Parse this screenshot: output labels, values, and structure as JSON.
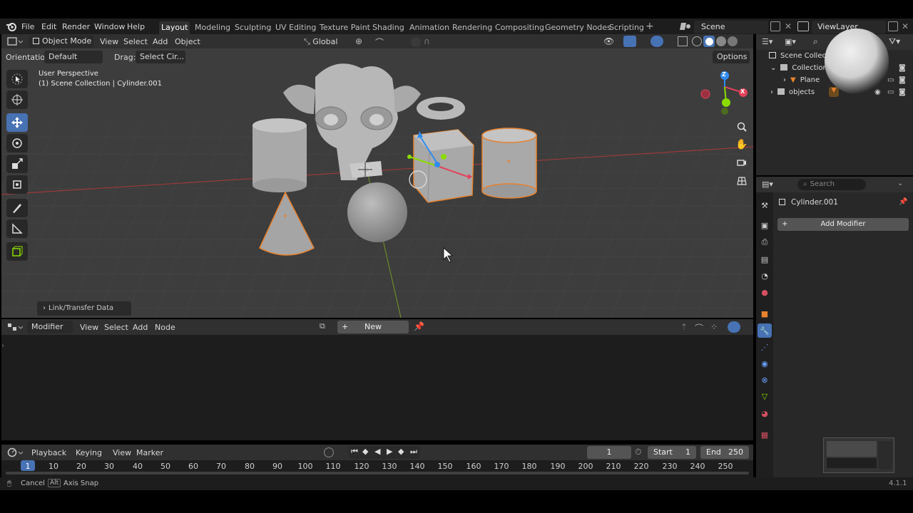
{
  "topbar": {
    "menus": [
      "File",
      "Edit",
      "Render",
      "Window",
      "Help"
    ],
    "workspaces": [
      "Layout",
      "Modeling",
      "Sculpting",
      "UV Editing",
      "Texture Paint",
      "Shading",
      "Animation",
      "Rendering",
      "Compositing",
      "Geometry Nodes",
      "Scripting"
    ],
    "active_workspace": "Layout",
    "scene_name": "Scene",
    "view_layer_name": "ViewLayer"
  },
  "viewport": {
    "mode": "Object Mode",
    "menus": [
      "View",
      "Select",
      "Add",
      "Object"
    ],
    "transform_orientation": "Global",
    "orientation_label": "Orientation:",
    "orientation_value": "Default",
    "drag_label": "Drag:",
    "drag_value": "Select Cir...",
    "options_label": "Options",
    "perspective": "User Perspective",
    "collection_info": "(1) Scene Collection | Cylinder.001",
    "last_op_panel": "Link/Transfer Data",
    "gizmo_axes": [
      "Z",
      "X"
    ]
  },
  "node_editor": {
    "type": "Modifier",
    "menus": [
      "View",
      "Select",
      "Add",
      "Node"
    ],
    "new_label": "New"
  },
  "outliner": {
    "items": [
      {
        "label": "Scene Collec",
        "indent": 0
      },
      {
        "label": "Collection",
        "indent": 1
      },
      {
        "label": "Plane",
        "indent": 2
      },
      {
        "label": "objects",
        "indent": 1
      }
    ]
  },
  "properties": {
    "search_placeholder": "Search",
    "object_name": "Cylinder.001",
    "add_modifier_label": "Add Modifier"
  },
  "timeline": {
    "menus": [
      "Playback",
      "Keying",
      "View",
      "Marker"
    ],
    "current_frame": "1",
    "start_label": "Start",
    "start_value": "1",
    "end_label": "End",
    "end_value": "250",
    "ruler": [
      "1",
      "10",
      "20",
      "30",
      "40",
      "50",
      "60",
      "70",
      "80",
      "90",
      "100",
      "110",
      "120",
      "130",
      "140",
      "150",
      "160",
      "170",
      "180",
      "190",
      "200",
      "210",
      "220",
      "230",
      "240",
      "250"
    ]
  },
  "statusbar": {
    "cancel_label": "Cancel",
    "alt_key": "Alt",
    "axis_snap_label": "Axis Snap",
    "version": "4.1.1"
  },
  "colors": {
    "accent": "#4772b3",
    "selection_outline": "#e8822d",
    "axis_x": "#e2425b",
    "axis_y": "#8bdc00",
    "axis_z": "#2e8cf0"
  }
}
